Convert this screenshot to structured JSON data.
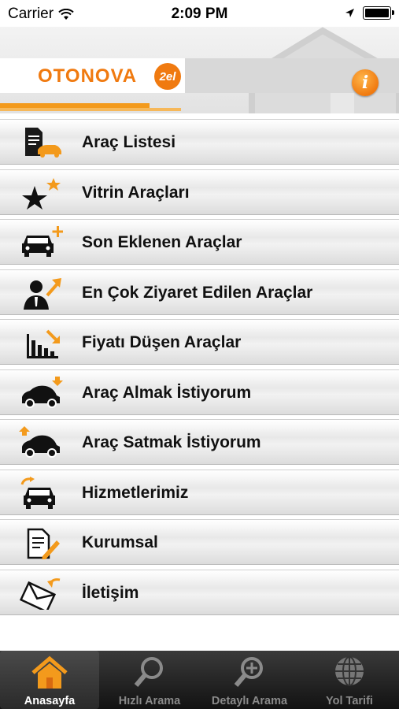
{
  "status_bar": {
    "carrier": "Carrier",
    "time": "2:09 PM"
  },
  "header": {
    "logo_text": "OTONOVA",
    "logo_badge": "2el",
    "info_glyph": "i"
  },
  "menu": {
    "items": [
      {
        "label": "Araç Listesi",
        "icon": "document-car-icon"
      },
      {
        "label": "Vitrin Araçları",
        "icon": "stars-icon"
      },
      {
        "label": "Son Eklenen Araçlar",
        "icon": "car-plus-icon"
      },
      {
        "label": "En Çok Ziyaret Edilen Araçlar",
        "icon": "person-trend-icon"
      },
      {
        "label": "Fiyatı Düşen Araçlar",
        "icon": "chart-down-icon"
      },
      {
        "label": "Araç Almak İstiyorum",
        "icon": "car-buy-icon"
      },
      {
        "label": "Araç Satmak İstiyorum",
        "icon": "car-sell-icon"
      },
      {
        "label": "Hizmetlerimiz",
        "icon": "car-service-icon"
      },
      {
        "label": "Kurumsal",
        "icon": "document-pen-icon"
      },
      {
        "label": "İletişim",
        "icon": "envelope-icon"
      }
    ]
  },
  "tabbar": {
    "tabs": [
      {
        "label": "Anasayfa",
        "icon": "home-icon",
        "active": true
      },
      {
        "label": "Hızlı Arama",
        "icon": "search-icon",
        "active": false
      },
      {
        "label": "Detaylı Arama",
        "icon": "zoom-plus-icon",
        "active": false
      },
      {
        "label": "Yol Tarifi",
        "icon": "globe-icon",
        "active": false
      }
    ]
  },
  "colors": {
    "accent": "#f07a10",
    "tabbar": "#1e1e1e"
  }
}
